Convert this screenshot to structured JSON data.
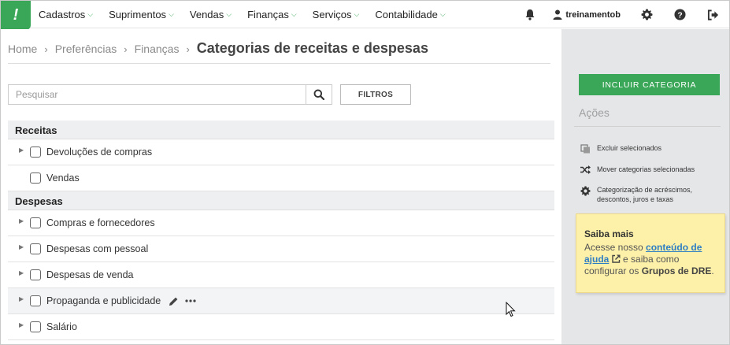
{
  "nav": {
    "items": [
      {
        "label": "Cadastros"
      },
      {
        "label": "Suprimentos"
      },
      {
        "label": "Vendas"
      },
      {
        "label": "Finanças"
      },
      {
        "label": "Serviços"
      },
      {
        "label": "Contabilidade"
      }
    ],
    "username": "treinamentob"
  },
  "breadcrumb": {
    "items": [
      "Home",
      "Preferências",
      "Finanças"
    ],
    "current": "Categorias de receitas e despesas"
  },
  "search": {
    "placeholder": "Pesquisar",
    "value": "",
    "filter_label": "FILTROS"
  },
  "groups": [
    {
      "title": "Receitas",
      "rows": [
        {
          "label": "Devoluções de compras",
          "expandable": true
        },
        {
          "label": "Vendas",
          "expandable": false
        }
      ]
    },
    {
      "title": "Despesas",
      "rows": [
        {
          "label": "Compras e fornecedores",
          "expandable": true
        },
        {
          "label": "Despesas com pessoal",
          "expandable": true
        },
        {
          "label": "Despesas de venda",
          "expandable": true
        },
        {
          "label": "Propaganda e publicidade",
          "expandable": true,
          "hovered": true
        },
        {
          "label": "Salário",
          "expandable": true
        }
      ]
    }
  ],
  "sidebar": {
    "include_label": "INCLUIR CATEGORIA",
    "actions_title": "Ações",
    "actions": [
      {
        "label": "Excluir selecionados",
        "icon": "trash-icon"
      },
      {
        "label": "Mover categorias selecionadas",
        "icon": "shuffle-icon"
      },
      {
        "label_line1": "Categorização de acréscimos,",
        "label_line2": "descontos, juros e taxas",
        "icon": "gear-icon"
      }
    ],
    "info": {
      "title": "Saiba mais",
      "text_prefix": "Acesse nosso ",
      "link": "conteúdo de ajuda",
      "text_mid": " e saiba como configurar os ",
      "strong": "Grupos de DRE",
      "text_suffix": "."
    }
  },
  "colors": {
    "brand_green": "#3aa657",
    "sidebar_bg": "#e5e6e8",
    "info_bg": "#fdf0a8",
    "link": "#2e7ec4"
  }
}
